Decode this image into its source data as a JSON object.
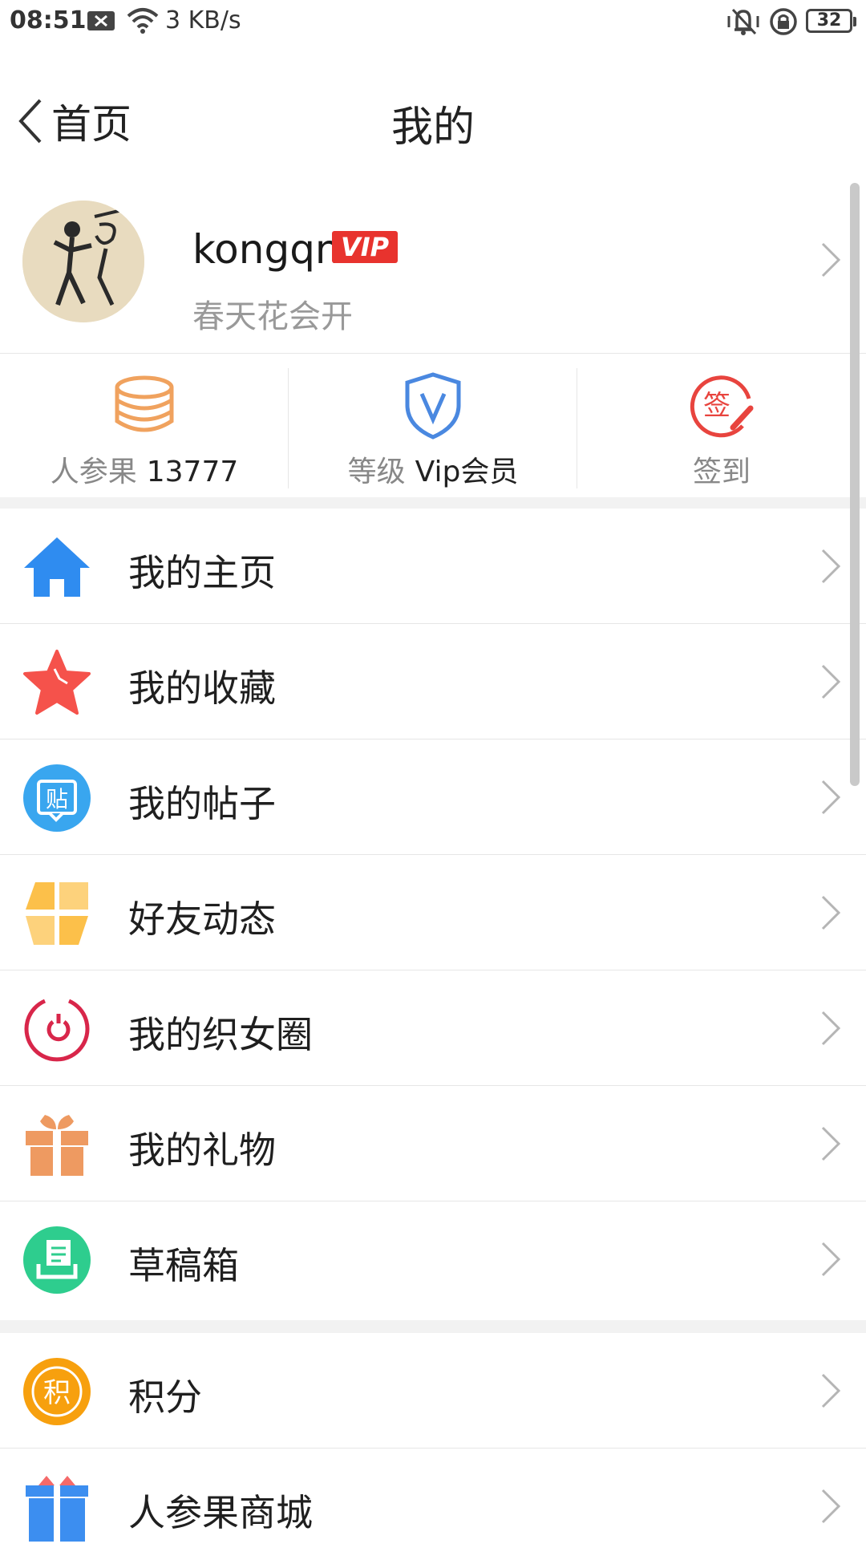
{
  "status_bar": {
    "time": "08:51",
    "network_speed": "3 KB/s",
    "battery": "32"
  },
  "header": {
    "back_label": "首页",
    "title": "我的"
  },
  "profile": {
    "username": "kongqn",
    "badge": "VIP",
    "signature": "春天花会开"
  },
  "stats": [
    {
      "label": "人参果",
      "value": "13777",
      "icon": "coin-stack-icon",
      "color": "#f0a25e"
    },
    {
      "label": "等级",
      "value": "Vip会员",
      "icon": "shield-v-icon",
      "color": "#4a88e0"
    },
    {
      "label": "签到",
      "value": "",
      "icon": "sign-in-icon",
      "color": "#e8443e"
    }
  ],
  "menu": [
    {
      "label": "我的主页",
      "icon": "home-icon",
      "color": "#2f8cf0"
    },
    {
      "label": "我的收藏",
      "icon": "star-icon",
      "color": "#f5524b"
    },
    {
      "label": "我的帖子",
      "icon": "post-icon",
      "color": "#39a6ef",
      "glyph": "贴"
    },
    {
      "label": "好友动态",
      "icon": "pinwheel-icon",
      "color": "#fcc04a"
    },
    {
      "label": "我的织女圈",
      "icon": "circle-icon",
      "color": "#d8264a"
    },
    {
      "label": "我的礼物",
      "icon": "gift-icon",
      "color": "#ee9a61"
    },
    {
      "label": "草稿箱",
      "icon": "draft-icon",
      "color": "#2ecd8e"
    }
  ],
  "menu2": [
    {
      "label": "积分",
      "icon": "points-icon",
      "color": "#f7a00e",
      "glyph": "积"
    },
    {
      "label": "人参果商城",
      "icon": "shop-gift-icon",
      "color": "#3c8ef0"
    }
  ]
}
